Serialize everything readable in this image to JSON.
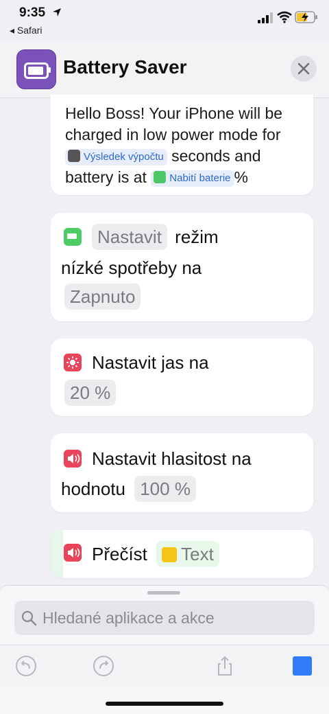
{
  "status_bar": {
    "time": "9:35",
    "back_app": "◂ Safari"
  },
  "header": {
    "title": "Battery Saver"
  },
  "card1": {
    "line1": "Hello Boss! Your iPhone will be charged in low power mode for",
    "token1": "Výsledek výpočtu",
    "mid": "seconds and battery is at",
    "token2": "Nabití baterie",
    "end": "%"
  },
  "card2": {
    "pill1": "Nastavit",
    "text1": "režim",
    "text2": "nízké spotřeby na",
    "pill2": "Zapnuto"
  },
  "card3": {
    "text": "Nastavit jas na",
    "pill": "20 %"
  },
  "card4": {
    "text1": "Nastavit hlasitost na",
    "text2": "hodnotu",
    "pill": "100 %"
  },
  "card5": {
    "text": "Přečíst",
    "pill": "Text"
  },
  "search": {
    "placeholder": "Hledané aplikace a akce"
  },
  "colors": {
    "accent": "#2f7cf6",
    "green": "#4dcc66",
    "red": "#e9445a",
    "purple": "#7b52b9"
  }
}
